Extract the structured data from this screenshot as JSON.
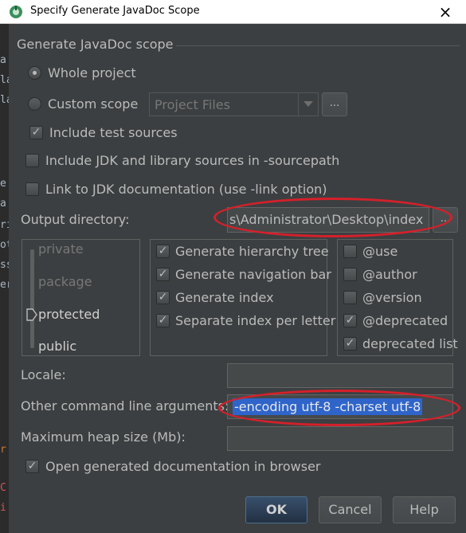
{
  "window": {
    "title": "Specify Generate JavaDoc Scope",
    "close_glyph": "×"
  },
  "scope": {
    "group_title": "Generate JavaDoc scope",
    "whole_project": "Whole project",
    "custom_scope": "Custom scope",
    "custom_scope_value": "Project Files",
    "browse_label": "...",
    "include_test_sources": "Include test sources",
    "include_test_sources_checked": true
  },
  "options": {
    "include_jdk": "Include JDK and library sources in -sourcepath",
    "include_jdk_checked": false,
    "link_jdk": "Link to JDK documentation (use -link option)",
    "link_jdk_checked": false
  },
  "output": {
    "label": "Output directory:",
    "value": "s\\Administrator\\Desktop\\index",
    "browse_label": "..."
  },
  "visibility": {
    "levels": [
      "private",
      "package",
      "protected",
      "public"
    ],
    "selected": "protected"
  },
  "generate": {
    "items": [
      {
        "label": "Generate hierarchy tree",
        "checked": true
      },
      {
        "label": "Generate navigation bar",
        "checked": true
      },
      {
        "label": "Generate index",
        "checked": true
      },
      {
        "label": "Separate index per letter",
        "checked": true
      }
    ]
  },
  "tags": {
    "items": [
      {
        "label": "@use",
        "checked": false
      },
      {
        "label": "@author",
        "checked": false
      },
      {
        "label": "@version",
        "checked": false
      },
      {
        "label": "@deprecated",
        "checked": true
      },
      {
        "label": "deprecated list",
        "checked": true
      }
    ]
  },
  "fields": {
    "locale_label": "Locale:",
    "locale_value": "",
    "cmdline_label": "Other command line arguments:",
    "cmdline_value": "-encoding utf-8 -charset utf-8",
    "heap_label": "Maximum heap size (Mb):",
    "heap_value": ""
  },
  "open_browser": {
    "label": "Open generated documentation in browser",
    "checked": true
  },
  "buttons": {
    "ok": "OK",
    "cancel": "Cancel",
    "help": "Help"
  },
  "background_editor": {
    "fragments": [
      "a",
      "la",
      "la",
      "e",
      "a",
      "ri",
      "ot",
      "ss",
      "er",
      "r",
      "C",
      "i"
    ]
  },
  "colors": {
    "dialog_bg": "#3c3f41",
    "text": "#bbbbbb",
    "selection": "#2f65ca",
    "annotation_ring": "#d5202a",
    "ok_button": "#2c3e55"
  }
}
